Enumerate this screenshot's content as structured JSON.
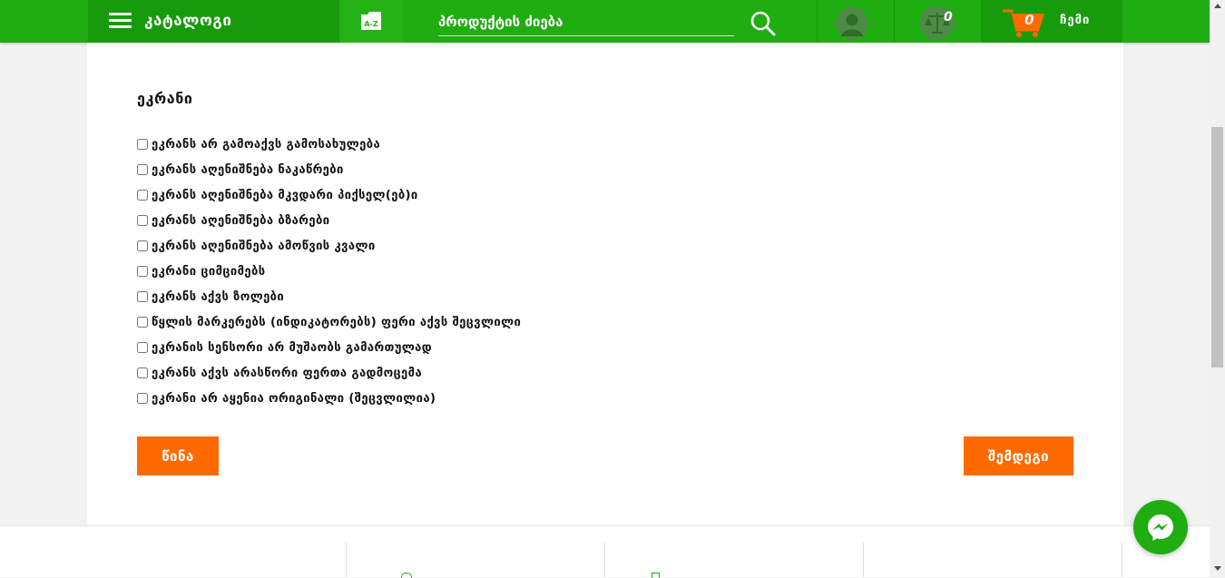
{
  "header": {
    "catalog_label": "კატალოგი",
    "az_label": "A-Z",
    "search_placeholder": "პროდუქტის ძიება",
    "compare_count": "0",
    "cart_count": "0",
    "cart_label": "ჩემი"
  },
  "section": {
    "title": "ეკრანი",
    "options": [
      "ეკრანს არ გამოაქვს გამოსახულება",
      "ეკრანს აღენიშნება ნაკაწრები",
      "ეკრანს აღენიშნება მკვდარი პიქსელ(ებ)ი",
      "ეკრანს აღენიშნება ბზარები",
      "ეკრანს აღენიშნება ამოწვის კვალი",
      "ეკრანი ციმციმებს",
      "ეკრანს აქვს ზოლები",
      "წყლის მარკერებს (ინდიკატორებს) ფერი აქვს შეცვლილი",
      "ეკრანის სენსორი არ მუშაობს გამართულად",
      "ეკრანს აქვს არასწორი ფერთა გადმოცემა",
      "ეკრანი არ აყენია ორიგინალი (შეცვლილია)"
    ]
  },
  "buttons": {
    "prev_label": "წინა",
    "next_label": "შემდეგი"
  },
  "colors": {
    "brand_green": "#1fad12",
    "accent_orange": "#ff6a00"
  }
}
